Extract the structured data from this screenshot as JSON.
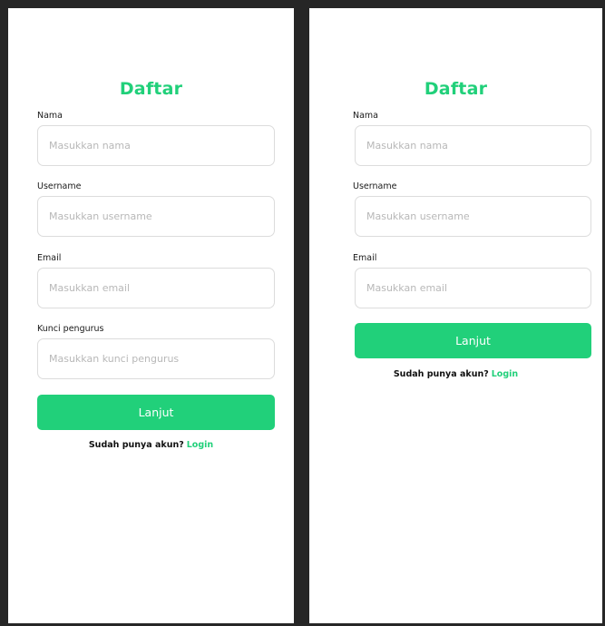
{
  "screens": [
    {
      "title": "Daftar",
      "fields": [
        {
          "label": "Nama",
          "placeholder": "Masukkan nama",
          "value": ""
        },
        {
          "label": "Username",
          "placeholder": "Masukkan username",
          "value": ""
        },
        {
          "label": "Email",
          "placeholder": "Masukkan email",
          "value": ""
        },
        {
          "label": "Kunci pengurus",
          "placeholder": "Masukkan kunci pengurus",
          "value": ""
        }
      ],
      "submit_label": "Lanjut",
      "footer_text": "Sudah punya akun?",
      "footer_link": "Login"
    },
    {
      "title": "Daftar",
      "fields": [
        {
          "label": "Nama",
          "placeholder": "Masukkan nama",
          "value": ""
        },
        {
          "label": "Username",
          "placeholder": "Masukkan username",
          "value": ""
        },
        {
          "label": "Email",
          "placeholder": "Masukkan email",
          "value": ""
        }
      ],
      "submit_label": "Lanjut",
      "footer_text": "Sudah punya akun?",
      "footer_link": "Login"
    }
  ],
  "colors": {
    "accent": "#21d07a",
    "background": "#262626",
    "surface": "#ffffff",
    "input_border": "#dcdcdc"
  }
}
